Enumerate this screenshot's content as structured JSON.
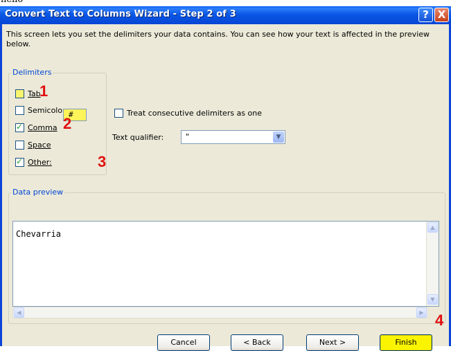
{
  "top_strip_text": "hello",
  "window": {
    "title": "Convert Text to Columns Wizard - Step 2 of 3",
    "help_label": "?",
    "close_label": "X"
  },
  "intro_text": "This screen lets you set the delimiters your data contains.  You can see how your text is affected in the preview below.",
  "delimiters": {
    "group_label": "Delimiters",
    "tab": {
      "label": "Tab",
      "checked": false
    },
    "semicolon": {
      "label": "Semicolon",
      "checked": false
    },
    "comma": {
      "label": "Comma",
      "checked": true
    },
    "space": {
      "label": "Space",
      "checked": false
    },
    "other": {
      "label": "Other:",
      "checked": true,
      "value": "#"
    }
  },
  "consecutive": {
    "label": "Treat consecutive delimiters as one",
    "checked": false
  },
  "text_qualifier": {
    "label": "Text qualifier:",
    "value": "\""
  },
  "annotations": {
    "n1": "1",
    "n2": "2",
    "n3": "3",
    "n4": "4"
  },
  "data_preview": {
    "group_label": "Data preview",
    "content": "Chevarria"
  },
  "buttons": {
    "cancel": "Cancel",
    "back": "< Back",
    "next": "Next >",
    "finish": "Finish"
  },
  "colors": {
    "title_bar": "#0a57e6",
    "highlight_yellow": "#fbf400",
    "annotation_red": "#e01010",
    "check_green": "#21a121"
  }
}
